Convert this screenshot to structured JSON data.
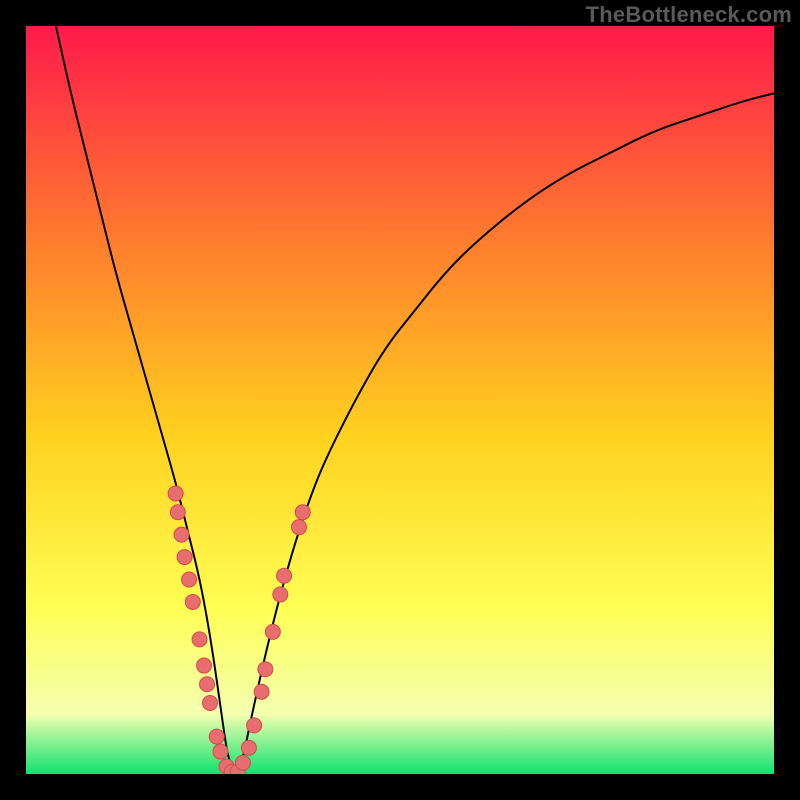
{
  "watermark": "TheBottleneck.com",
  "colors": {
    "frame": "#000000",
    "curve": "#000000",
    "dot_fill": "#e86d6e",
    "dot_stroke": "#d24b4c",
    "grad_top": "#ff1a4b",
    "grad_mid1": "#ff7a2e",
    "grad_mid2": "#ffd21f",
    "grad_mid3": "#ffff55",
    "grad_mid4": "#f3ffb0",
    "grad_bottom": "#0fe26e"
  },
  "chart_data": {
    "type": "line",
    "title": "",
    "xlabel": "",
    "ylabel": "",
    "xlim": [
      0,
      100
    ],
    "ylim": [
      0,
      100
    ],
    "grid": false,
    "legend": false,
    "series": [
      {
        "name": "bottleneck-curve",
        "x": [
          4,
          6,
          8,
          10,
          12,
          14,
          16,
          18,
          20,
          21,
          22,
          23,
          24,
          25,
          26,
          27,
          28,
          29,
          30,
          32,
          34,
          36,
          38,
          40,
          44,
          48,
          52,
          56,
          60,
          66,
          72,
          78,
          84,
          90,
          96,
          100
        ],
        "y": [
          100,
          91,
          83,
          75,
          67,
          60,
          53,
          46,
          39,
          35,
          31,
          27,
          22,
          16,
          9,
          2,
          0,
          2,
          7,
          16,
          24,
          31,
          37,
          42,
          50,
          57,
          62,
          67,
          71,
          76,
          80,
          83,
          86,
          88,
          90,
          91
        ]
      }
    ],
    "points": [
      {
        "x": 20.0,
        "y": 37.5
      },
      {
        "x": 20.3,
        "y": 35.0
      },
      {
        "x": 20.8,
        "y": 32.0
      },
      {
        "x": 21.2,
        "y": 29.0
      },
      {
        "x": 21.8,
        "y": 26.0
      },
      {
        "x": 22.3,
        "y": 23.0
      },
      {
        "x": 23.2,
        "y": 18.0
      },
      {
        "x": 23.8,
        "y": 14.5
      },
      {
        "x": 24.2,
        "y": 12.0
      },
      {
        "x": 24.6,
        "y": 9.5
      },
      {
        "x": 25.5,
        "y": 5.0
      },
      {
        "x": 26.0,
        "y": 3.0
      },
      {
        "x": 26.8,
        "y": 1.0
      },
      {
        "x": 27.5,
        "y": 0.3
      },
      {
        "x": 28.3,
        "y": 0.3
      },
      {
        "x": 29.0,
        "y": 1.5
      },
      {
        "x": 29.8,
        "y": 3.5
      },
      {
        "x": 30.5,
        "y": 6.5
      },
      {
        "x": 31.5,
        "y": 11.0
      },
      {
        "x": 32.0,
        "y": 14.0
      },
      {
        "x": 33.0,
        "y": 19.0
      },
      {
        "x": 34.0,
        "y": 24.0
      },
      {
        "x": 34.5,
        "y": 26.5
      },
      {
        "x": 36.5,
        "y": 33.0
      },
      {
        "x": 37.0,
        "y": 35.0
      }
    ],
    "gradient_stops": [
      {
        "pct": 0,
        "color": "grad_top"
      },
      {
        "pct": 28,
        "color": "grad_mid1"
      },
      {
        "pct": 55,
        "color": "grad_mid2"
      },
      {
        "pct": 78,
        "color": "grad_mid3"
      },
      {
        "pct": 92,
        "color": "grad_mid4"
      },
      {
        "pct": 100,
        "color": "grad_bottom"
      }
    ]
  }
}
